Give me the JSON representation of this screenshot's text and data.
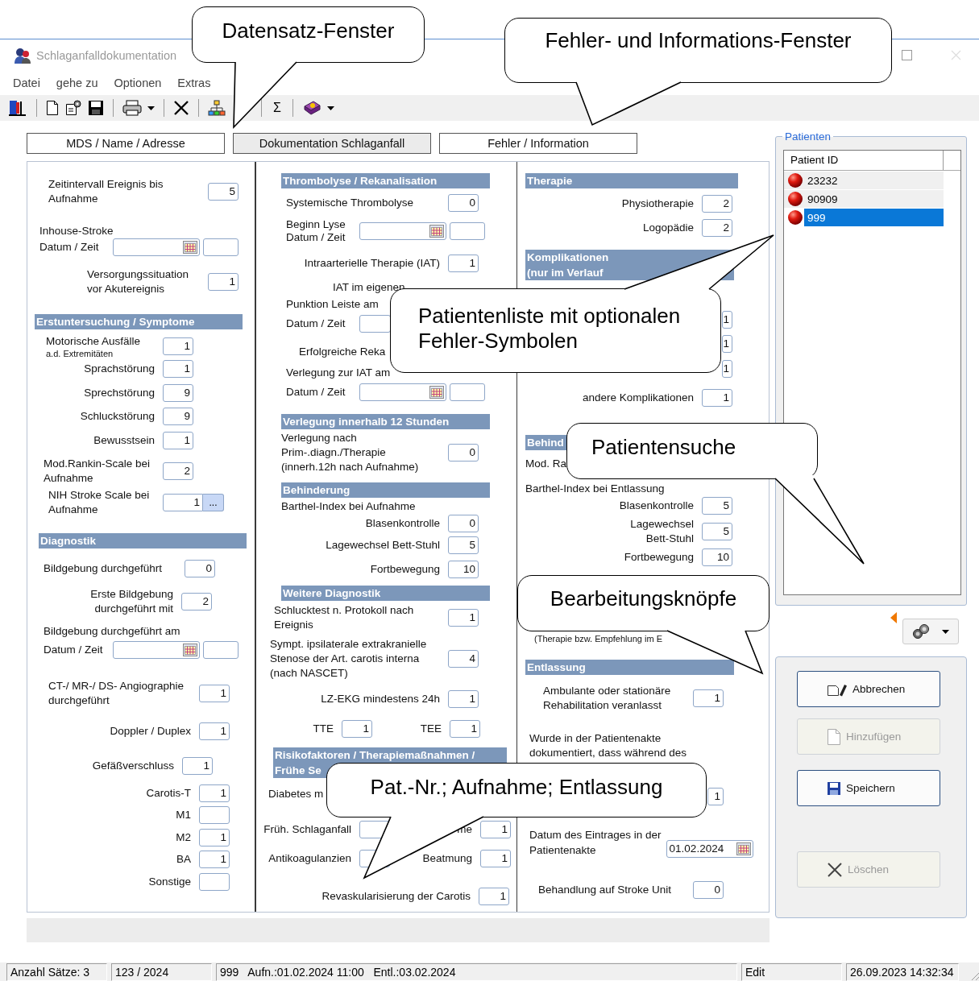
{
  "window": {
    "title": "Schlaganfalldokumentation"
  },
  "menu": [
    {
      "label": "Datei"
    },
    {
      "label": "gehe zu"
    },
    {
      "label": "Optionen"
    },
    {
      "label": "Extras"
    }
  ],
  "toolbar": {
    "sum_button": "Σ"
  },
  "tabs": [
    {
      "label": "MDS / Name / Adresse",
      "selected": false
    },
    {
      "label": "Dokumentation Schlaganfall",
      "selected": true
    },
    {
      "label": "Fehler / Information",
      "selected": false
    }
  ],
  "form": {
    "columns": [
      {
        "rows": [
          {
            "kind": "field",
            "label": "Zeitintervall Ereignis bis\nAufnahme",
            "value": "5"
          },
          {
            "kind": "text",
            "label": "Inhouse-Stroke"
          },
          {
            "kind": "datetime",
            "label": "Datum / Zeit"
          },
          {
            "kind": "field",
            "label": "Versorgungssituation\nvor Akutereignis",
            "value": "1"
          },
          {
            "kind": "section",
            "title": "Erstuntersuchung / Symptome"
          },
          {
            "kind": "field",
            "label": "Motorische Ausfälle",
            "sublabel": "a.d. Extremitäten",
            "value": "1"
          },
          {
            "kind": "field",
            "label": "Sprachstörung",
            "value": "1"
          },
          {
            "kind": "field",
            "label": "Sprechstörung",
            "value": "9"
          },
          {
            "kind": "field",
            "label": "Schluckstörung",
            "value": "9"
          },
          {
            "kind": "field",
            "label": "Bewusstsein",
            "value": "1"
          },
          {
            "kind": "field",
            "label": "Mod.Rankin-Scale bei\nAufnahme",
            "value": "2"
          },
          {
            "kind": "field",
            "label": "NIH Stroke Scale bei\nAufnahme",
            "value": "1",
            "button": "..."
          },
          {
            "kind": "section",
            "title": "Diagnostik"
          },
          {
            "kind": "field",
            "label": "Bildgebung durchgeführt",
            "value": "0"
          },
          {
            "kind": "field",
            "label": "Erste Bildgebung\ndurchgeführt mit",
            "value": "2"
          },
          {
            "kind": "text",
            "label": "Bildgebung durchgeführt am"
          },
          {
            "kind": "datetime",
            "label": "Datum / Zeit"
          },
          {
            "kind": "field",
            "label": "CT-/ MR-/ DS- Angiographie\ndurchgeführt",
            "value": "1"
          },
          {
            "kind": "field",
            "label": "Doppler / Duplex",
            "value": "1"
          },
          {
            "kind": "field",
            "label": "Gefäßverschluss",
            "value": "1"
          },
          {
            "kind": "field",
            "label": "Carotis-T",
            "value": "1"
          },
          {
            "kind": "field",
            "label": "M1"
          },
          {
            "kind": "field",
            "label": "M2",
            "value": "1"
          },
          {
            "kind": "field",
            "label": "BA",
            "value": "1"
          },
          {
            "kind": "field",
            "label": "Sonstige"
          }
        ]
      },
      {
        "rows": [
          {
            "kind": "section",
            "title": "Thrombolyse / Rekanalisation"
          },
          {
            "kind": "field",
            "label": "Systemische Thrombolyse",
            "value": "0"
          },
          {
            "kind": "datetime",
            "label": "Beginn Lyse\nDatum / Zeit"
          },
          {
            "kind": "field",
            "label": "Intraarterielle Therapie (IAT)",
            "value": "1"
          },
          {
            "kind": "text",
            "label": "IAT im eigenen"
          },
          {
            "kind": "text",
            "label": "Punktion Leiste am"
          },
          {
            "kind": "datetime",
            "label": "Datum / Zeit"
          },
          {
            "kind": "text",
            "label": "Erfolgreiche Reka"
          },
          {
            "kind": "text",
            "label": "Verlegung zur IAT am"
          },
          {
            "kind": "datetime",
            "label": "Datum / Zeit"
          },
          {
            "kind": "section",
            "title": "Verlegung innerhalb 12 Stunden"
          },
          {
            "kind": "field",
            "label": "Verlegung nach\nPrim-.diagn./Therapie\n(innerh.12h nach Aufnahme)",
            "value": "0"
          },
          {
            "kind": "section",
            "title": "Behinderung"
          },
          {
            "kind": "text",
            "label": "Barthel-Index bei Aufnahme"
          },
          {
            "kind": "field",
            "label": "Blasenkontrolle",
            "value": "0"
          },
          {
            "kind": "field",
            "label": "Lagewechsel Bett-Stuhl",
            "value": "5"
          },
          {
            "kind": "field",
            "label": "Fortbewegung",
            "value": "10"
          },
          {
            "kind": "section",
            "title": "Weitere Diagnostik"
          },
          {
            "kind": "field",
            "label": "Schlucktest n. Protokoll nach\nEreignis",
            "value": "1"
          },
          {
            "kind": "field",
            "label": "Sympt. ipsilaterale extrakranielle\nStenose der Art. carotis interna\n(nach NASCET)",
            "value": "4"
          },
          {
            "kind": "field",
            "label": "LZ-EKG mindestens 24h",
            "value": "1"
          },
          {
            "kind": "pair",
            "items": [
              {
                "label": "TTE",
                "value": "1"
              },
              {
                "label": "TEE",
                "value": "1"
              }
            ]
          },
          {
            "kind": "section",
            "title": "Risikofaktoren / Therapiemaßnahmen /\nFrühe Se"
          },
          {
            "kind": "text",
            "label": "Diabetes m"
          },
          {
            "kind": "pair",
            "items": [
              {
                "label": "Früh. Schlaganfall"
              },
              {
                "label": "me",
                "value": "1"
              }
            ]
          },
          {
            "kind": "pair",
            "items": [
              {
                "label": "Antikoagulanzien"
              },
              {
                "label": "Beatmung",
                "value": "1"
              }
            ]
          },
          {
            "kind": "field",
            "label": "Revaskularisierung der Carotis",
            "value": "1"
          }
        ]
      },
      {
        "rows": [
          {
            "kind": "section",
            "title": "Therapie"
          },
          {
            "kind": "field",
            "label": "Physiotherapie",
            "value": "2"
          },
          {
            "kind": "field",
            "label": "Logopädie",
            "value": "2"
          },
          {
            "kind": "section",
            "title": "Komplikationen\n(nur im Verlauf"
          },
          {
            "kind": "field",
            "value": "1"
          },
          {
            "kind": "field",
            "value": "1"
          },
          {
            "kind": "field",
            "value": "1"
          },
          {
            "kind": "field",
            "label": "andere Komplikationen",
            "value": "1"
          },
          {
            "kind": "section",
            "title": "Behind"
          },
          {
            "kind": "text",
            "label": "Mod. Ra"
          },
          {
            "kind": "text",
            "label": "Barthel-Index bei Entlassung"
          },
          {
            "kind": "field",
            "label": "Blasenkontrolle",
            "value": "5"
          },
          {
            "kind": "field",
            "label": "Lagewechsel\nBett-Stuhl",
            "value": "5"
          },
          {
            "kind": "field",
            "label": "Fortbewegung",
            "value": "10"
          },
          {
            "kind": "note",
            "label": "(Therapie bzw. Empfehlung im E"
          },
          {
            "kind": "section",
            "title": "Entlassung"
          },
          {
            "kind": "field",
            "label": "Ambulante oder stationäre\nRehabilitation veranlasst",
            "value": "1"
          },
          {
            "kind": "text",
            "label": "Wurde in der Patientenakte\ndokumentiert, dass während des"
          },
          {
            "kind": "field",
            "value": "1"
          },
          {
            "kind": "date",
            "label": "Datum des Eintrages in der\nPatientenakte",
            "date": "01.02.2024"
          },
          {
            "kind": "field",
            "label": "Behandlung auf Stroke Unit",
            "value": "0"
          }
        ]
      }
    ]
  },
  "patients": {
    "title": "Patienten",
    "columns": [
      "Patient ID"
    ],
    "rows": [
      {
        "id": "23232",
        "selected": false
      },
      {
        "id": "90909",
        "selected": false
      },
      {
        "id": "999",
        "selected": true
      }
    ]
  },
  "buttons": [
    {
      "kind": "cancel",
      "label": "Abbrechen",
      "disabled": false
    },
    {
      "kind": "add",
      "label": "Hinzufügen",
      "disabled": true
    },
    {
      "kind": "save",
      "label": "Speichern",
      "disabled": false
    },
    {
      "kind": "delete",
      "label": "Löschen",
      "disabled": true
    }
  ],
  "status_bar": [
    "Anzahl Sätze: 3",
    "123 / 2024",
    "999   Aufn.:01.02.2024 11:00   Entl.:03.02.2024",
    "Edit",
    "26.09.2023 14:32:34"
  ],
  "callouts": [
    {
      "text": "Datensatz-Fenster"
    },
    {
      "text": "Fehler- und Informations-Fenster"
    },
    {
      "text": "Patientenliste mit optionalen\nFehler-Symbolen"
    },
    {
      "text": "Patientensuche"
    },
    {
      "text": "Bearbeitungsknöpfe"
    },
    {
      "text": "Pat.-Nr.; Aufnahme; Entlassung"
    }
  ]
}
